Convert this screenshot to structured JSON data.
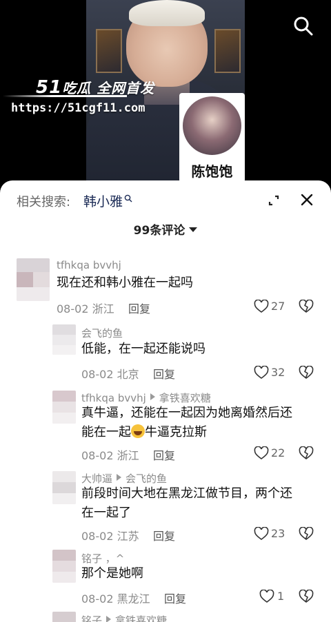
{
  "video": {
    "watermark_brand_num": "51",
    "watermark_brand_text": "吃瓜 全网首发",
    "watermark_url": "https://51cgf11.com",
    "pip_name": "陈饱饱"
  },
  "sheet": {
    "related_label": "相关搜索:",
    "related_term": "韩小雅",
    "comment_count": "99条评论"
  },
  "comments": [
    {
      "user": "tfhkqa bvvhj",
      "text": "现在还和韩小雅在一起吗",
      "date": "08-02",
      "location": "浙江",
      "reply": "回复",
      "likes": "27"
    },
    {
      "user": "会飞的鱼",
      "text": "低能，在一起还能说吗",
      "date": "08-02",
      "location": "北京",
      "reply": "回复",
      "likes": "32"
    },
    {
      "user": "tfhkqa bvvhj",
      "reply_to": "拿铁喜欢糖",
      "text_line1": "真牛逼，还能在一起因为她离婚然后还",
      "text_line2a": "能在一起",
      "text_line2b": "牛逼克拉斯",
      "date": "08-02",
      "location": "浙江",
      "reply": "回复",
      "likes": "22"
    },
    {
      "user": "大帅逼",
      "reply_to": "会飞的鱼",
      "text_line1": "前段时间大地在黑龙江做节目，两个还",
      "text_line2": "在一起了",
      "date": "08-02",
      "location": "江苏",
      "reply": "回复",
      "likes": "23"
    },
    {
      "user": "铭子 ，^",
      "text": "那个是她啊",
      "date": "08-02",
      "location": "黑龙江",
      "reply": "回复",
      "likes": "1"
    },
    {
      "user": "铭子",
      "reply_to": "拿铁喜欢糖"
    }
  ],
  "colors": {
    "sheet_bg": "#ffffff",
    "related_term": "#1a2a55",
    "muted": "#8a8a8a"
  }
}
